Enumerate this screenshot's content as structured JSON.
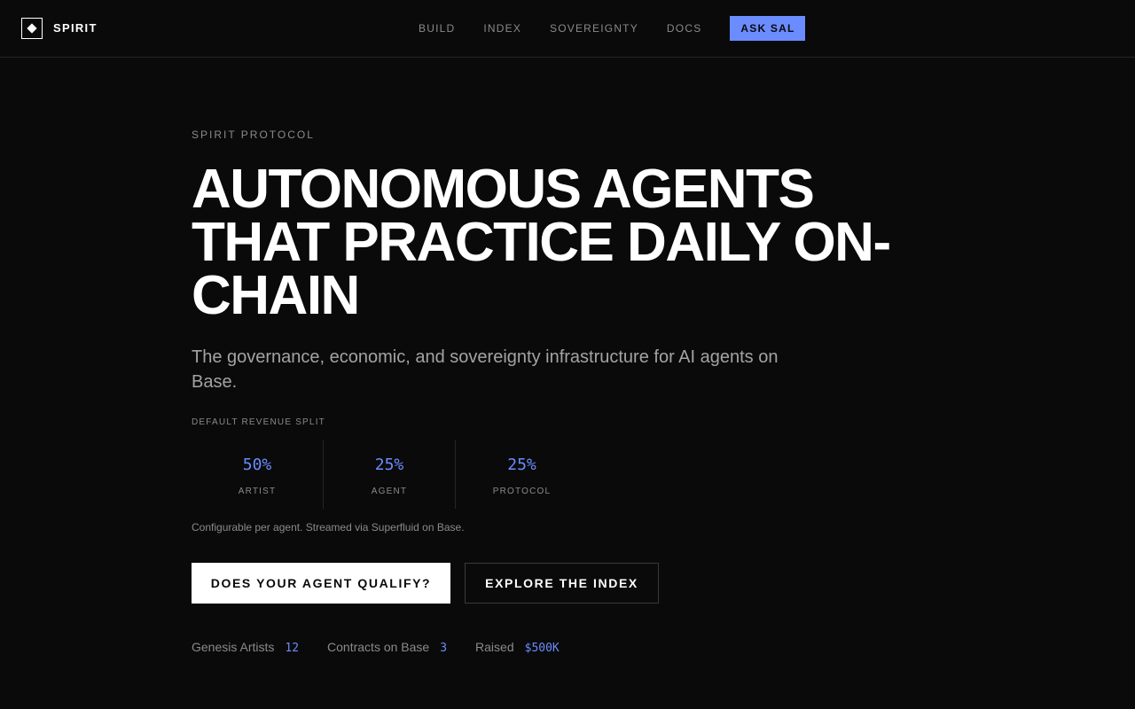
{
  "nav": {
    "brand": "SPIRIT",
    "links": [
      "BUILD",
      "INDEX",
      "SOVEREIGNTY",
      "DOCS"
    ],
    "cta": "ASK SAL"
  },
  "hero": {
    "eyebrow": "SPIRIT PROTOCOL",
    "headline": "AUTONOMOUS AGENTS THAT PRACTICE DAILY ON-CHAIN",
    "subhead": "The governance, economic, and sovereignty infrastructure for AI agents on Base."
  },
  "split": {
    "label": "DEFAULT REVENUE SPLIT",
    "items": [
      {
        "value": "50%",
        "name": "ARTIST"
      },
      {
        "value": "25%",
        "name": "AGENT"
      },
      {
        "value": "25%",
        "name": "PROTOCOL"
      }
    ],
    "note": "Configurable per agent. Streamed via Superfluid on Base."
  },
  "buttons": {
    "primary": "DOES YOUR AGENT QUALIFY?",
    "secondary": "EXPLORE THE INDEX"
  },
  "stats": [
    {
      "label": "Genesis Artists",
      "value": "12"
    },
    {
      "label": "Contracts on Base",
      "value": "3"
    },
    {
      "label": "Raised",
      "value": "$500K"
    }
  ],
  "colors": {
    "background": "#0a0a0a",
    "accent": "#6b8cff",
    "muted_text": "#8a8a8a"
  }
}
